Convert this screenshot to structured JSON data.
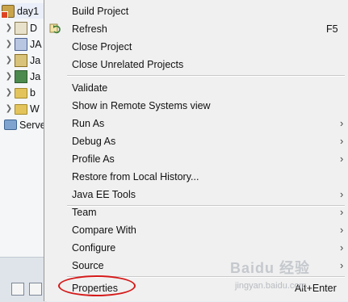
{
  "explorer": {
    "root_label": "day1",
    "items": [
      {
        "label": "D",
        "icon": "deployment-descriptor-icon"
      },
      {
        "label": "JA",
        "icon": "jax-ws-icon"
      },
      {
        "label": "Ja",
        "icon": "java-resources-icon"
      },
      {
        "label": "Ja",
        "icon": "javascript-resources-icon"
      },
      {
        "label": "b",
        "icon": "folder-icon"
      },
      {
        "label": "W",
        "icon": "folder-icon"
      }
    ],
    "servers_label": "Serve"
  },
  "menu": {
    "items": [
      {
        "label": "Build Project",
        "accelerator": "",
        "submenu": false
      },
      {
        "label": "Refresh",
        "accelerator": "F5",
        "submenu": false,
        "icon": "refresh-icon"
      },
      {
        "label": "Close Project",
        "accelerator": "",
        "submenu": false
      },
      {
        "label": "Close Unrelated Projects",
        "accelerator": "",
        "submenu": false
      },
      {
        "label": "Validate",
        "accelerator": "",
        "submenu": false
      },
      {
        "label": "Show in Remote Systems view",
        "accelerator": "",
        "submenu": false
      },
      {
        "label": "Run As",
        "accelerator": "",
        "submenu": true
      },
      {
        "label": "Debug As",
        "accelerator": "",
        "submenu": true
      },
      {
        "label": "Profile As",
        "accelerator": "",
        "submenu": true
      },
      {
        "label": "Restore from Local History...",
        "accelerator": "",
        "submenu": false
      },
      {
        "label": "Java EE Tools",
        "accelerator": "",
        "submenu": true
      },
      {
        "label": "Team",
        "accelerator": "",
        "submenu": true
      },
      {
        "label": "Compare With",
        "accelerator": "",
        "submenu": true
      },
      {
        "label": "Configure",
        "accelerator": "",
        "submenu": true
      },
      {
        "label": "Source",
        "accelerator": "",
        "submenu": true
      },
      {
        "label": "Properties",
        "accelerator": "Alt+Enter",
        "submenu": false
      }
    ],
    "submenu_glyph": "›",
    "highlight_color": "#d51a1a"
  },
  "watermark": {
    "logo_text": "Baidu 经验",
    "url": "jingyan.baidu.com"
  }
}
